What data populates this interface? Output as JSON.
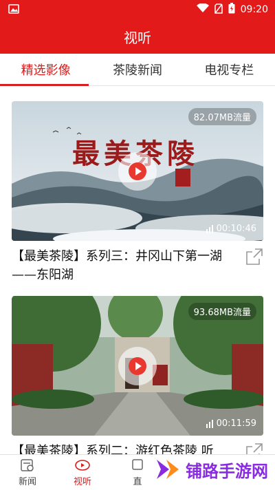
{
  "status_bar": {
    "time": "09:20"
  },
  "header": {
    "title": "视听"
  },
  "tabs": [
    {
      "label": "精选影像",
      "active": true
    },
    {
      "label": "茶陵新闻",
      "active": false
    },
    {
      "label": "电视专栏",
      "active": false
    }
  ],
  "videos": [
    {
      "size": "82.07MB流量",
      "duration": "00:10:46",
      "title": "【最美茶陵】系列三：井冈山下第一湖——东阳湖",
      "overlay_text": "最美茶陵"
    },
    {
      "size": "93.68MB流量",
      "duration": "00:11:59",
      "title": "【最美茶陵】系列二：游红色茶陵 听"
    }
  ],
  "bottom_nav": [
    {
      "label": "新闻",
      "icon": "news-icon",
      "active": false
    },
    {
      "label": "视听",
      "icon": "media-icon",
      "active": true
    },
    {
      "label": "直",
      "icon": "live-icon",
      "active": false
    }
  ],
  "watermark": {
    "text": "铺路手游网"
  },
  "colors": {
    "brand_red": "#e31a1a",
    "active_red": "#d81e1e",
    "watermark_purple": "#8a2be2"
  }
}
